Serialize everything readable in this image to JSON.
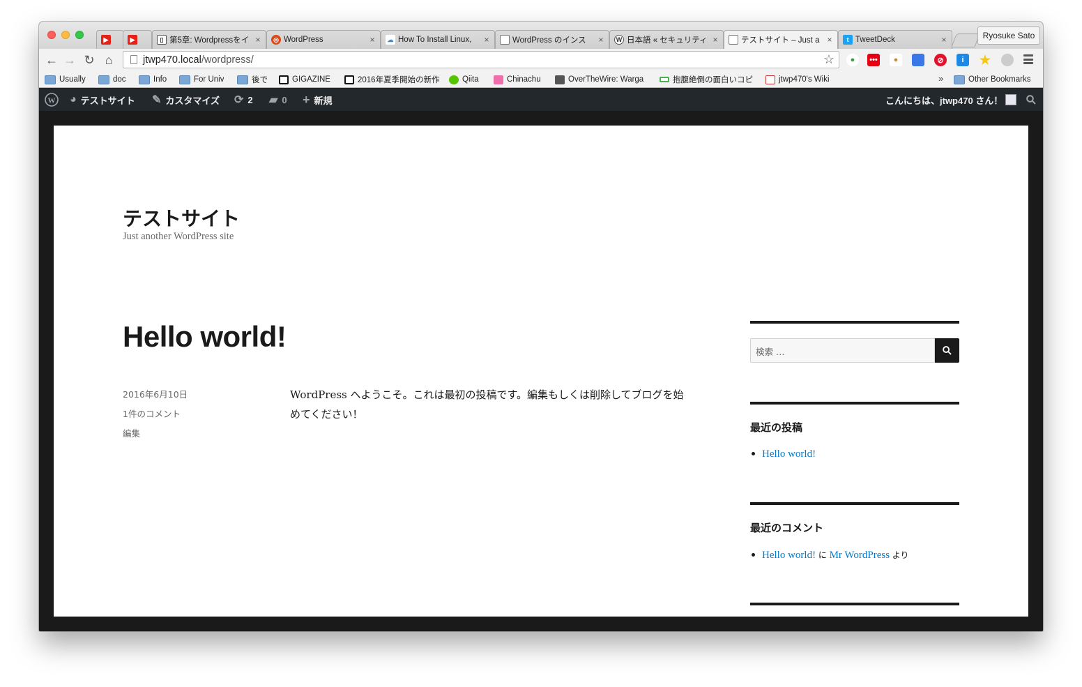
{
  "browser": {
    "tabs": [
      {
        "label": "",
        "icon": "youtube-icon"
      },
      {
        "label": "",
        "icon": "youtube-icon"
      },
      {
        "label": "第5章: Wordpressをイ",
        "icon": "book-icon"
      },
      {
        "label": "WordPress",
        "icon": "ubuntu-icon"
      },
      {
        "label": "How To Install Linux,",
        "icon": "cloud-icon"
      },
      {
        "label": "WordPress のインス",
        "icon": "page-icon"
      },
      {
        "label": "日本語 « セキュリティ",
        "icon": "wordpress-icon"
      },
      {
        "label": "テストサイト – Just a",
        "icon": "page-icon"
      },
      {
        "label": "TweetDeck",
        "icon": "twitter-icon"
      }
    ],
    "tab_close": "×",
    "profile_name": "Ryosuke Sato",
    "url_host": "jtwp470.local",
    "url_path": "/wordpress/",
    "bookmarks": [
      {
        "label": "Usually",
        "icon": "folder-icon"
      },
      {
        "label": "doc",
        "icon": "folder-icon"
      },
      {
        "label": "Info",
        "icon": "folder-icon"
      },
      {
        "label": "For Univ",
        "icon": "folder-icon"
      },
      {
        "label": "後で",
        "icon": "folder-icon"
      },
      {
        "label": "GIGAZINE",
        "icon": "gigazine-icon"
      },
      {
        "label": "2016年夏季開始の新作",
        "icon": "gigazine-icon"
      },
      {
        "label": "Qiita",
        "icon": "qiita-icon"
      },
      {
        "label": "Chinachu",
        "icon": "chinachu-icon"
      },
      {
        "label": "OverTheWire: Warga",
        "icon": "overthewire-icon"
      },
      {
        "label": "抱腹絶倒の面白いコピ",
        "icon": "battery-icon"
      },
      {
        "label": "jtwp470's Wiki",
        "icon": "wiki-icon"
      }
    ],
    "bookmarks_more": "»",
    "other_bookmarks": "Other Bookmarks"
  },
  "adminbar": {
    "site_name": "テストサイト",
    "customize": "カスタマイズ",
    "updates_count": "2",
    "comments_count": "0",
    "new_label": "新規",
    "greeting": "こんにちは、jtwp470 さん！"
  },
  "site": {
    "title": "テストサイト",
    "description": "Just another WordPress site"
  },
  "post": {
    "title": "Hello world!",
    "date": "2016年6月10日",
    "comments_link": "1件のコメント",
    "edit_link": "編集",
    "content_line1": "WordPress へようこそ。これは最初の投稿です。編集もしくは削除してブログを始",
    "content_line2": "めてください！"
  },
  "sidebar": {
    "search_placeholder": "検索 …",
    "recent_posts_title": "最近の投稿",
    "recent_posts": [
      "Hello world!"
    ],
    "recent_comments_title": "最近のコメント",
    "recent_comment": {
      "post": "Hello world!",
      "on": "に",
      "author": "Mr WordPress",
      "from": "より"
    }
  },
  "colors": {
    "adminbar_bg": "#23282d",
    "link": "#007acc",
    "text": "#1a1a1a"
  }
}
